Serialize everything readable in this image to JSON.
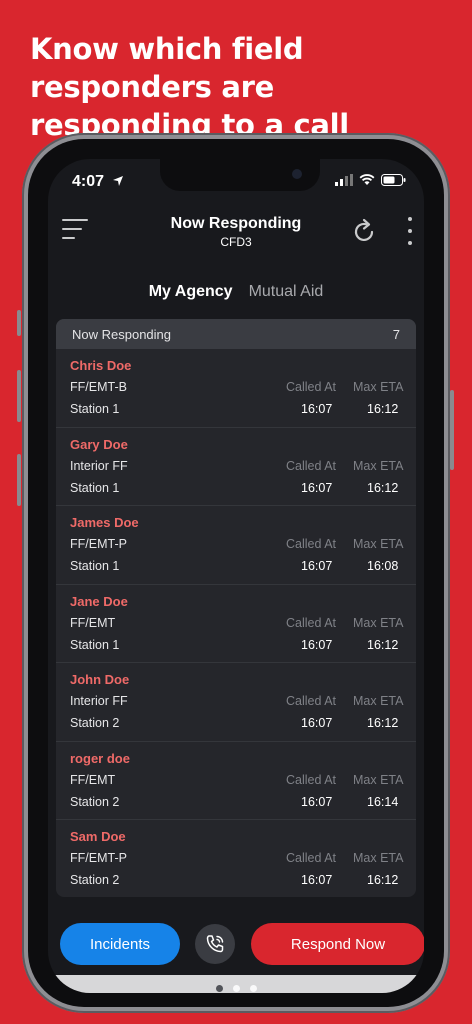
{
  "headline": "Know which field responders are responding to a call",
  "status": {
    "time": "4:07"
  },
  "header": {
    "title": "Now Responding",
    "subtitle": "CFD3"
  },
  "tabs": [
    {
      "label": "My Agency",
      "active": true
    },
    {
      "label": "Mutual Aid",
      "active": false
    }
  ],
  "list": {
    "title": "Now Responding",
    "count": "7",
    "col_called": "Called At",
    "col_maxeta": "Max ETA",
    "responders": [
      {
        "name": "Chris Doe",
        "role": "FF/EMT-B",
        "station": "Station 1",
        "called_at": "16:07",
        "max_eta": "16:12"
      },
      {
        "name": "Gary Doe",
        "role": "Interior FF",
        "station": "Station 1",
        "called_at": "16:07",
        "max_eta": "16:12"
      },
      {
        "name": "James Doe",
        "role": "FF/EMT-P",
        "station": "Station 1",
        "called_at": "16:07",
        "max_eta": "16:08"
      },
      {
        "name": "Jane Doe",
        "role": "FF/EMT",
        "station": "Station 1",
        "called_at": "16:07",
        "max_eta": "16:12"
      },
      {
        "name": "John Doe",
        "role": "Interior FF",
        "station": "Station 2",
        "called_at": "16:07",
        "max_eta": "16:12"
      },
      {
        "name": "roger doe",
        "role": "FF/EMT",
        "station": "Station 2",
        "called_at": "16:07",
        "max_eta": "16:14"
      },
      {
        "name": "Sam Doe",
        "role": "FF/EMT-P",
        "station": "Station 2",
        "called_at": "16:07",
        "max_eta": "16:12"
      }
    ]
  },
  "buttons": {
    "incidents": "Incidents",
    "respond": "Respond Now"
  },
  "colors": {
    "brand_red": "#d9262e",
    "accent_blue": "#1683e8",
    "name_red": "#ef6a68"
  }
}
